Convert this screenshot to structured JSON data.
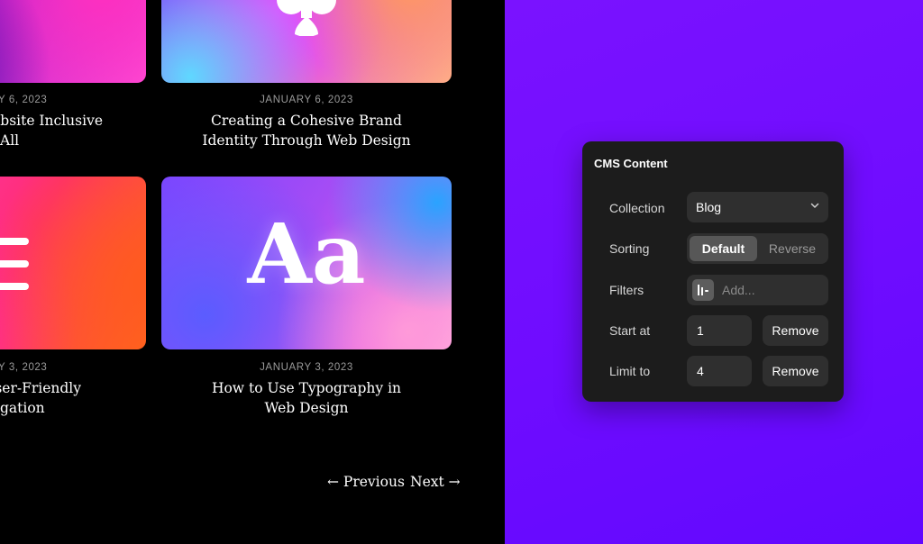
{
  "blog": {
    "posts": [
      {
        "date": "Y 6, 2023",
        "title_line1": "ebsite Inclusive",
        "title_line2": "All"
      },
      {
        "date": "JANUARY 6, 2023",
        "title_line1": "Creating a Cohesive Brand",
        "title_line2": "Identity Through Web Design"
      },
      {
        "date": "Y 3, 2023",
        "title_line1": "ser-Friendly",
        "title_line2": "gation"
      },
      {
        "date": "JANUARY 3, 2023",
        "title_line1": "How to Use Typography in",
        "title_line2": "Web Design"
      }
    ],
    "card_a_glyph": "y",
    "card_d_glyph": "Aa",
    "pagination": {
      "previous": "← Previous",
      "next": "Next →"
    }
  },
  "cms": {
    "title": "CMS Content",
    "collection": {
      "label": "Collection",
      "value": "Blog"
    },
    "sorting": {
      "label": "Sorting",
      "options": [
        "Default",
        "Reverse"
      ],
      "selected": "Default"
    },
    "filters": {
      "label": "Filters",
      "placeholder": "Add..."
    },
    "start_at": {
      "label": "Start at",
      "value": "1",
      "remove": "Remove"
    },
    "limit_to": {
      "label": "Limit to",
      "value": "4",
      "remove": "Remove"
    }
  },
  "colors": {
    "panel_bg": "#1c1c1c",
    "accent_purple": "#6f0cff",
    "field_bg": "#2f2f2f"
  },
  "icons": [
    "chevron-down-icon",
    "filter-icon",
    "list-lines-icon",
    "drop-icon"
  ]
}
